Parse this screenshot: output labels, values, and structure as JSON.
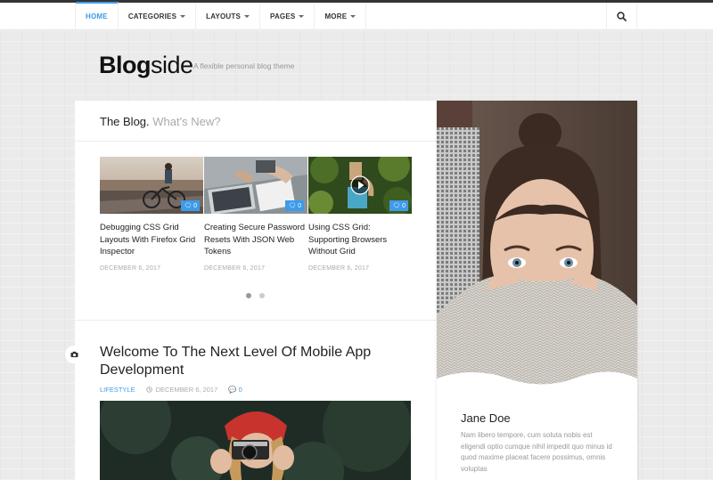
{
  "nav": {
    "items": [
      {
        "label": "HOME",
        "active": true,
        "caret": false
      },
      {
        "label": "CATEGORIES",
        "active": false,
        "caret": true
      },
      {
        "label": "LAYOUTS",
        "active": false,
        "caret": true
      },
      {
        "label": "PAGES",
        "active": false,
        "caret": true
      },
      {
        "label": "MORE",
        "active": false,
        "caret": true
      }
    ],
    "search_icon": "search-icon"
  },
  "brand": {
    "logo_bold": "Blog",
    "logo_light": "side",
    "tagline": "A flexible personal blog theme"
  },
  "section": {
    "title": "The Blog.",
    "subtitle": "What's New?"
  },
  "slides": [
    {
      "title": "Debugging CSS Grid Layouts With Firefox Grid Inspector",
      "date": "DECEMBER 6, 2017",
      "comments": "0"
    },
    {
      "title": "Creating Secure Password Resets With JSON Web Tokens",
      "date": "DECEMBER 6, 2017",
      "comments": "0"
    },
    {
      "title": "Using CSS Grid: Supporting Browsers Without Grid",
      "date": "DECEMBER 6, 2017",
      "comments": "0"
    }
  ],
  "post": {
    "title": "Welcome To The Next Level Of Mobile App Development",
    "category": "LIFESTYLE",
    "date": "DECEMBER 6, 2017",
    "comments": "0"
  },
  "author": {
    "name": "Jane Doe",
    "bio": "Nam libero tempore, cum soluta nobis est eligendi optio cumque nihil impedit quo minus id quod maxime placeat facere possimus, omnis voluptas"
  },
  "colors": {
    "accent": "#3d9be9",
    "text": "#222222",
    "muted": "#aaaaaa"
  }
}
